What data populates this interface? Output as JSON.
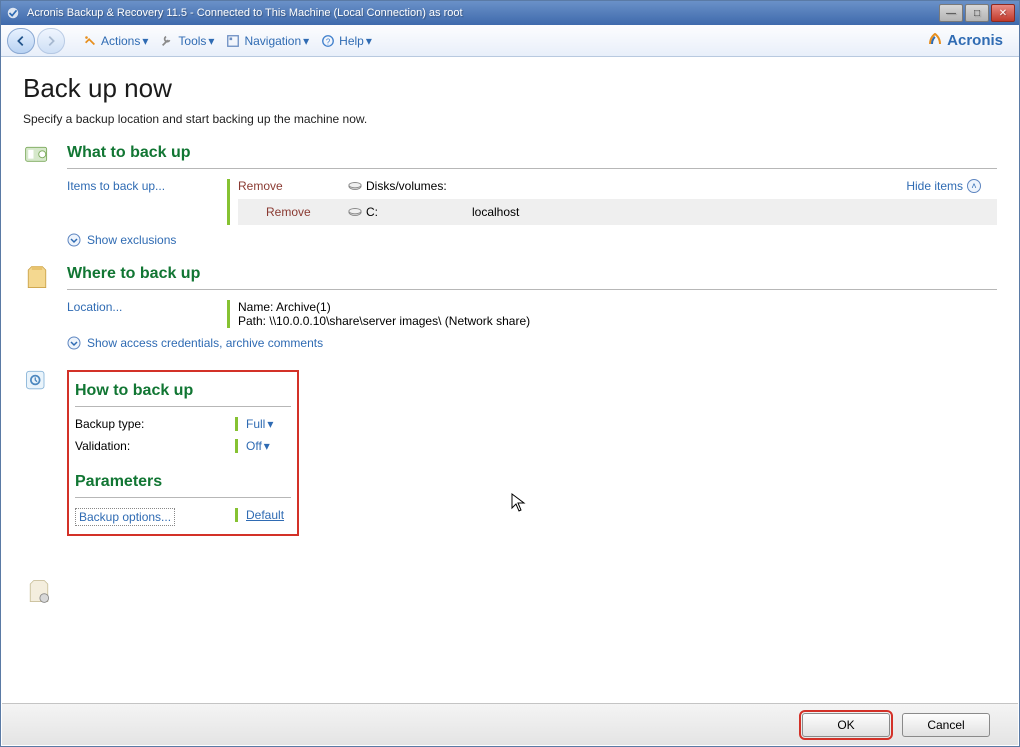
{
  "titlebar": {
    "title": "Acronis Backup & Recovery 11.5 - Connected to This Machine (Local Connection) as root"
  },
  "toolbar": {
    "actions": "Actions",
    "tools": "Tools",
    "navigation": "Navigation",
    "help": "Help"
  },
  "brand": "Acronis",
  "page": {
    "title": "Back up now",
    "subtitle": "Specify a backup location and start backing up the machine now."
  },
  "sections": {
    "what": {
      "title": "What to back up",
      "items_to_back_up": "Items to back up...",
      "remove": "Remove",
      "disks_volumes": "Disks/volumes:",
      "hide_items": "Hide items",
      "remove2": "Remove",
      "drive": "C:",
      "host": "localhost",
      "show_exclusions": "Show exclusions"
    },
    "where": {
      "title": "Where to back up",
      "location_link": "Location...",
      "name_line": "Name: Archive(1)",
      "path_line": "Path: \\\\10.0.0.10\\share\\server images\\ (Network share)",
      "show_credentials": "Show access credentials, archive comments"
    },
    "how": {
      "title": "How to back up",
      "backup_type_label": "Backup type:",
      "backup_type_value": "Full",
      "validation_label": "Validation:",
      "validation_value": "Off"
    },
    "params": {
      "title": "Parameters",
      "backup_options": "Backup options...",
      "default": "Default"
    }
  },
  "footer": {
    "ok": "OK",
    "cancel": "Cancel"
  }
}
